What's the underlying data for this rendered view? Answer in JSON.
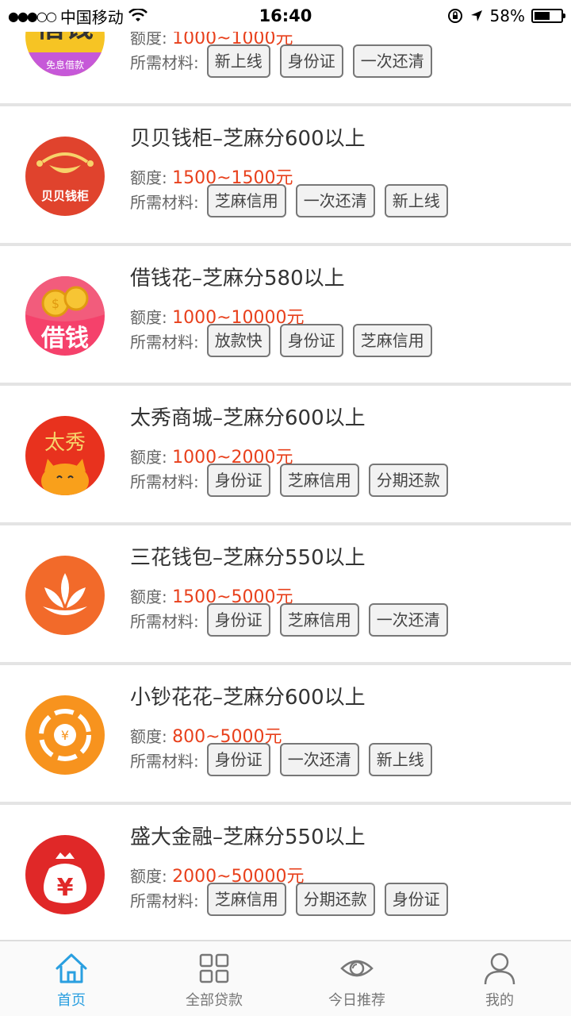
{
  "status_bar": {
    "carrier": "中国移动",
    "time": "16:40",
    "battery": "58%",
    "battery_level": 0.58
  },
  "loans": [
    {
      "title": "",
      "amount_label": "额度:",
      "amount": "1000~1000元",
      "materials_label": "所需材料:",
      "tags": [
        "新上线",
        "身份证",
        "一次还清"
      ],
      "logo_icon": "jieqian-logo-icon",
      "logo_text": "借钱",
      "logo_sub": "免息借款"
    },
    {
      "title": "贝贝钱柜–芝麻分600以上",
      "amount_label": "额度:",
      "amount": "1500~1500元",
      "materials_label": "所需材料:",
      "tags": [
        "芝麻信用",
        "一次还清",
        "新上线"
      ],
      "logo_icon": "beibei-logo-icon",
      "logo_text": "贝贝钱柜"
    },
    {
      "title": "借钱花–芝麻分580以上",
      "amount_label": "额度:",
      "amount": "1000~10000元",
      "materials_label": "所需材料:",
      "tags": [
        "放款快",
        "身份证",
        "芝麻信用"
      ],
      "logo_icon": "jieqianhua-logo-icon",
      "logo_text": "借钱"
    },
    {
      "title": "太秀商城–芝麻分600以上",
      "amount_label": "额度:",
      "amount": "1000~2000元",
      "materials_label": "所需材料:",
      "tags": [
        "身份证",
        "芝麻信用",
        "分期还款"
      ],
      "logo_icon": "taixiu-logo-icon",
      "logo_text": "太秀"
    },
    {
      "title": "三花钱包–芝麻分550以上",
      "amount_label": "额度:",
      "amount": "1500~5000元",
      "materials_label": "所需材料:",
      "tags": [
        "身份证",
        "芝麻信用",
        "一次还清"
      ],
      "logo_icon": "sanhua-logo-icon"
    },
    {
      "title": "小钞花花–芝麻分600以上",
      "amount_label": "额度:",
      "amount": "800~5000元",
      "materials_label": "所需材料:",
      "tags": [
        "身份证",
        "一次还清",
        "新上线"
      ],
      "logo_icon": "xiaochao-logo-icon"
    },
    {
      "title": "盛大金融–芝麻分550以上",
      "amount_label": "额度:",
      "amount": "2000~50000元",
      "materials_label": "所需材料:",
      "tags": [
        "芝麻信用",
        "分期还款",
        "身份证"
      ],
      "logo_icon": "shengda-logo-icon"
    }
  ],
  "tab_bar": {
    "tabs": [
      {
        "label": "首页",
        "icon": "home-icon",
        "active": true
      },
      {
        "label": "全部贷款",
        "icon": "grid-icon",
        "active": false
      },
      {
        "label": "今日推荐",
        "icon": "eye-icon",
        "active": false
      },
      {
        "label": "我的",
        "icon": "user-icon",
        "active": false
      }
    ]
  },
  "colors": {
    "accent": "#2a9fe0",
    "amount": "#e8401c"
  }
}
